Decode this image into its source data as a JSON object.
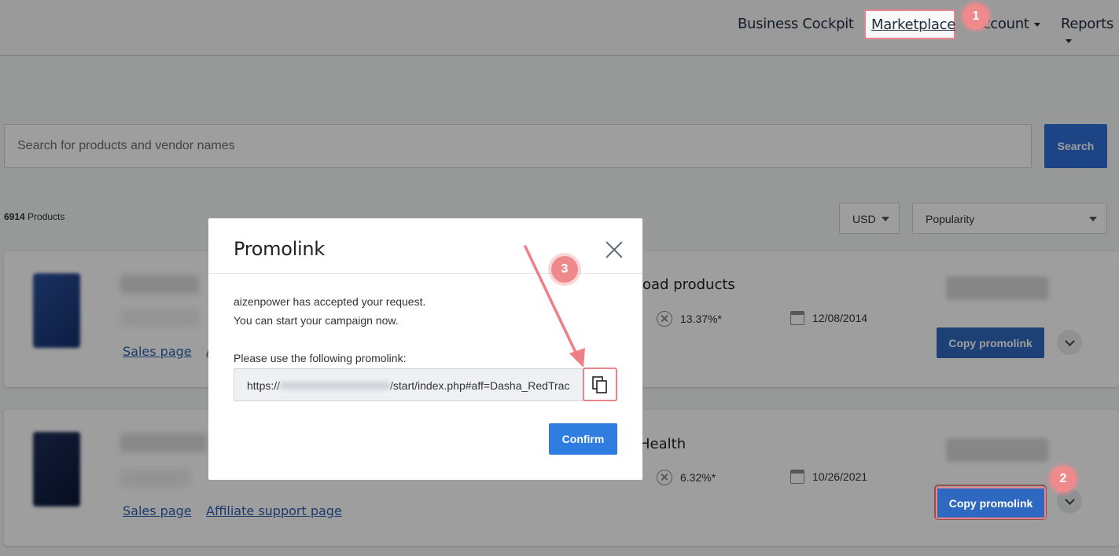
{
  "nav": {
    "items": [
      {
        "label": "Business Cockpit"
      },
      {
        "label": "Marketplace"
      },
      {
        "label": "Account"
      },
      {
        "label": "Reports"
      }
    ]
  },
  "search": {
    "placeholder": "Search for products and vendor names",
    "button_label": "Search"
  },
  "results": {
    "count": "6914",
    "count_suffix": " Products",
    "currency": "USD",
    "sort": "Popularity"
  },
  "products": [
    {
      "category": "oad products",
      "refund_rate": "13.37%*",
      "date": "12/08/2014",
      "sales_link": "Sales page",
      "affiliate_link": "A",
      "copy_label": "Copy promolink"
    },
    {
      "category": "Health",
      "refund_rate": "6.32%*",
      "date": "10/26/2021",
      "sales_link": "Sales page",
      "affiliate_link": "Affiliate support page",
      "copy_label": "Copy promolink"
    }
  ],
  "modal": {
    "title": "Promolink",
    "line1": "aizenpower has accepted your request.",
    "line2": "You can start your campaign now.",
    "instruction": "Please use the following promolink:",
    "link_prefix": "https://",
    "link_suffix": "/start/index.php#aff=Dasha_RedTrac",
    "confirm_label": "Confirm"
  },
  "annotations": {
    "step1": "1",
    "step2": "2",
    "step3": "3",
    "highlight_color": "#e8848a"
  },
  "colors": {
    "primary": "#2f6fd6",
    "link": "#2a5fb0"
  }
}
